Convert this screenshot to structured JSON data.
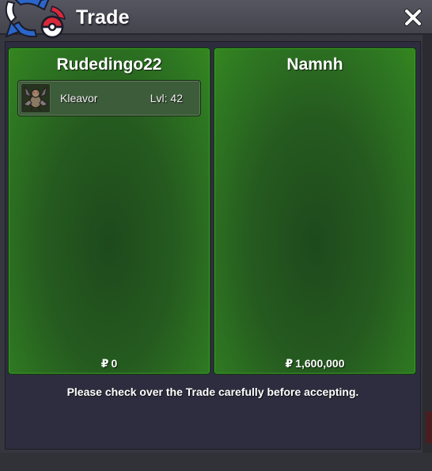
{
  "window": {
    "title": "Trade",
    "close_icon": "close-icon",
    "logo_icon": "trade-exchange-icon"
  },
  "left_panel": {
    "player_name": "Rudedingo22",
    "money": "0",
    "currency_icon": "pokedollar-icon",
    "currency_symbol": "₽",
    "items": [
      {
        "name": "Kleavor",
        "level": "Lvl: 42",
        "sprite_icon": "kleavor-sprite-icon"
      }
    ]
  },
  "right_panel": {
    "player_name": "Namnh",
    "money": "1,600,000",
    "currency_icon": "pokedollar-icon",
    "currency_symbol": "₽",
    "items": []
  },
  "notice": "Please check over the Trade carefully before accepting.",
  "colors": {
    "panel_green": "#2f7a22",
    "panel_dark_green": "#1e4a1c",
    "frame_bg": "#2e2d3f",
    "titlebar": "#4e4e58",
    "accent_red": "#d8283a",
    "accent_blue": "#2a66c9"
  }
}
